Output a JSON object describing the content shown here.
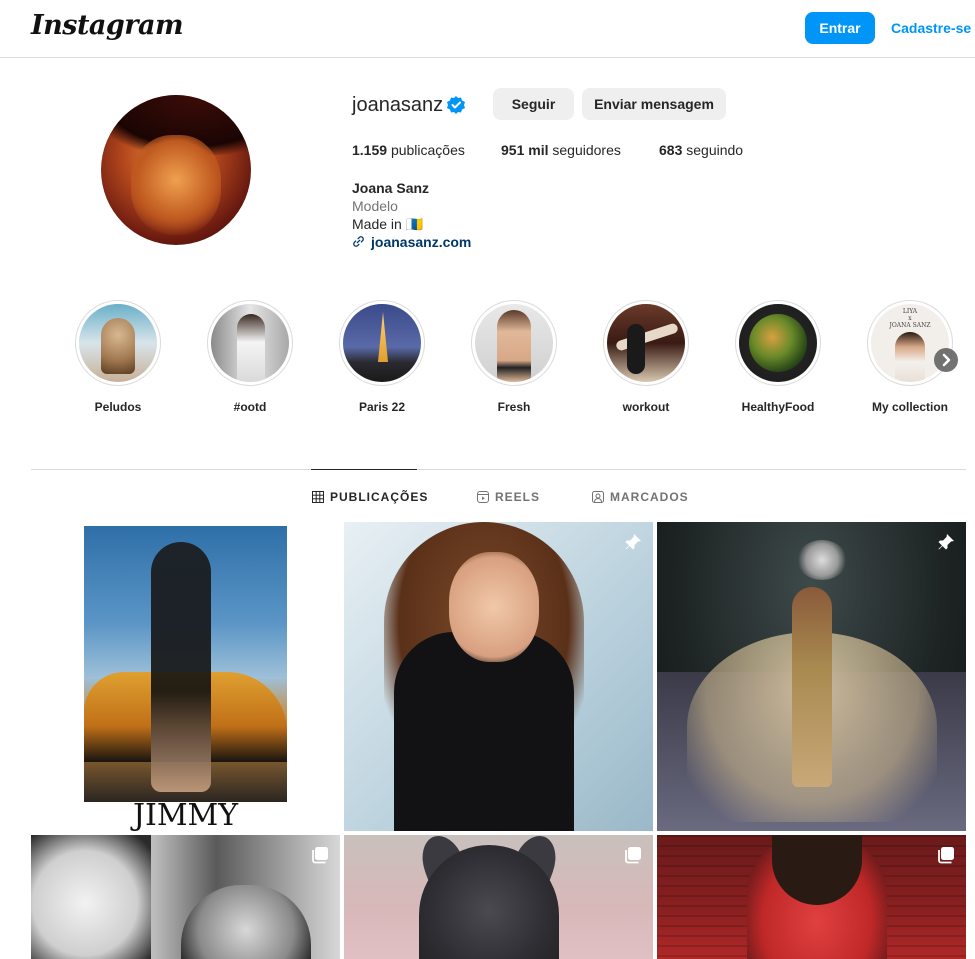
{
  "nav": {
    "logo": "Instagram",
    "login_label": "Entrar",
    "signup_label": "Cadastre-se"
  },
  "profile": {
    "username": "joanasanz",
    "verified": true,
    "follow_label": "Seguir",
    "message_label": "Enviar mensagem",
    "posts_count": "1.159",
    "posts_label": "publicações",
    "followers_count": "951 mil",
    "followers_label": "seguidores",
    "following_count": "683",
    "following_label": "seguindo",
    "full_name": "Joana Sanz",
    "category": "Modelo",
    "bio": "Made in 🇮🇨",
    "website": "joanasanz.com"
  },
  "highlights": [
    {
      "label": "Peludos"
    },
    {
      "label": "#ootd"
    },
    {
      "label": "Paris 22"
    },
    {
      "label": "Fresh"
    },
    {
      "label": "workout"
    },
    {
      "label": "HealthyFood"
    },
    {
      "label": "My collection"
    }
  ],
  "tabs": [
    {
      "label": "PUBLICAÇÕES",
      "active": true,
      "icon": "grid-icon"
    },
    {
      "label": "REELS",
      "active": false,
      "icon": "reels-icon"
    },
    {
      "label": "MARCADOS",
      "active": false,
      "icon": "tagged-icon"
    }
  ],
  "posts": [
    {
      "brand_text": "JIMMY CHOO",
      "badge": "none"
    },
    {
      "badge": "pin-icon"
    },
    {
      "badge": "pin-icon"
    },
    {
      "badge": "carousel-icon"
    },
    {
      "badge": "carousel-icon"
    },
    {
      "badge": "carousel-icon"
    }
  ],
  "colors": {
    "accent": "#0095f6",
    "link": "#00376b",
    "border": "#dbdbdb",
    "secondary_text": "#737373",
    "button_bg": "#efefef",
    "verified": "#0095f6"
  }
}
